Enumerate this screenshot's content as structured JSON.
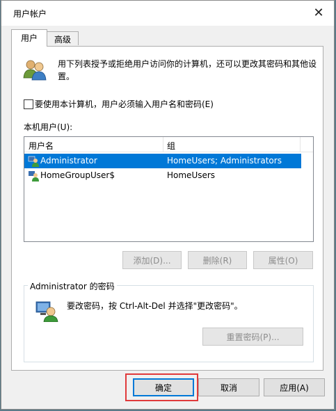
{
  "window": {
    "title": "用户帐户",
    "close_glyph": "✕"
  },
  "tabs": [
    {
      "label": "用户"
    },
    {
      "label": "高级"
    }
  ],
  "intro": {
    "text": "用下列表授予或拒绝用户访问你的计算机，还可以更改其密码和其他设置。"
  },
  "require_login": {
    "label": "要使用本计算机，用户必须输入用户名和密码(E)",
    "checked": false
  },
  "local_users": {
    "label": "本机用户(U):",
    "columns": [
      "用户名",
      "组"
    ],
    "rows": [
      {
        "name": "Administrator",
        "group": "HomeUsers; Administrators",
        "selected": true
      },
      {
        "name": "HomeGroupUser$",
        "group": "HomeUsers",
        "selected": false
      }
    ]
  },
  "user_buttons": {
    "add": "添加(D)...",
    "remove": "删除(R)",
    "properties": "属性(O)"
  },
  "password_group": {
    "title": "Administrator 的密码",
    "text": "要改密码，按 Ctrl-Alt-Del 并选择\"更改密码\"。",
    "reset_button": "重置密码(P)..."
  },
  "footer_buttons": {
    "ok": "确定",
    "cancel": "取消",
    "apply": "应用(A)"
  },
  "colors": {
    "selection": "#0078d7",
    "highlight_box": "#e0393b",
    "focus_border": "#0078d7"
  }
}
